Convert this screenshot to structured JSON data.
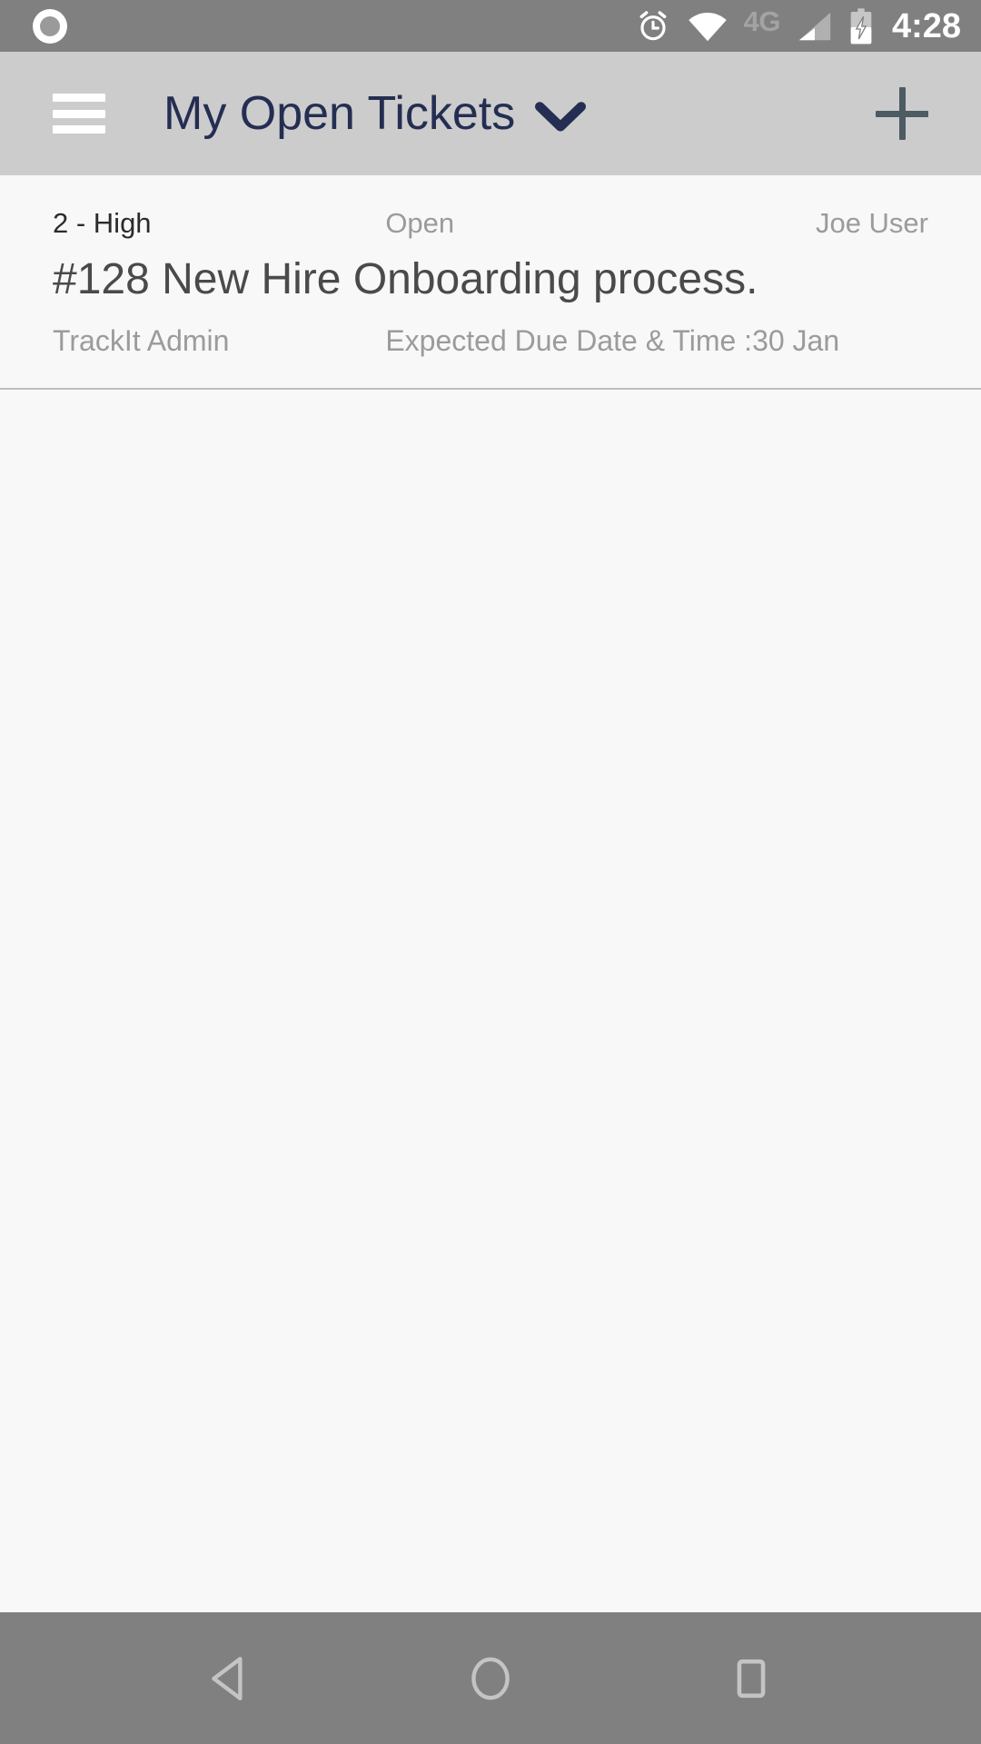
{
  "status_bar": {
    "notification_icon": "circle-notification-icon",
    "alarm_icon": "alarm-clock-icon",
    "wifi_icon": "wifi-icon",
    "network_label": "4G",
    "signal_icon": "signal-bars-icon",
    "battery_icon": "battery-charging-icon",
    "time": "4:28",
    "background_color": "#808080",
    "text_color": "#ffffff",
    "dim_color": "#a3a3a3"
  },
  "app_bar": {
    "menu_icon": "hamburger-menu-icon",
    "title": "My Open Tickets",
    "dropdown_icon": "chevron-down-icon",
    "add_icon": "plus-icon",
    "background_color": "#cccccc",
    "title_color": "#242e52",
    "menu_color": "#ffffff",
    "add_color": "#4d5b63"
  },
  "ticket_list": {
    "items": [
      {
        "priority": "2 - High",
        "status": "Open",
        "assignee": "Joe User",
        "title": "#128 New Hire Onboarding process.",
        "requester": "TrackIt Admin",
        "due": "Expected Due Date & Time :30 Jan"
      }
    ],
    "background_color": "#f8f8f8",
    "divider_color": "#bdbdbd",
    "muted_text_color": "#9b9b9b",
    "title_text_color": "#4a4a4a"
  },
  "nav_bar": {
    "back_icon": "back-triangle-icon",
    "home_icon": "home-circle-icon",
    "recents_icon": "recents-square-icon",
    "background_color": "#808080",
    "icon_color": "#c4c4c4"
  }
}
